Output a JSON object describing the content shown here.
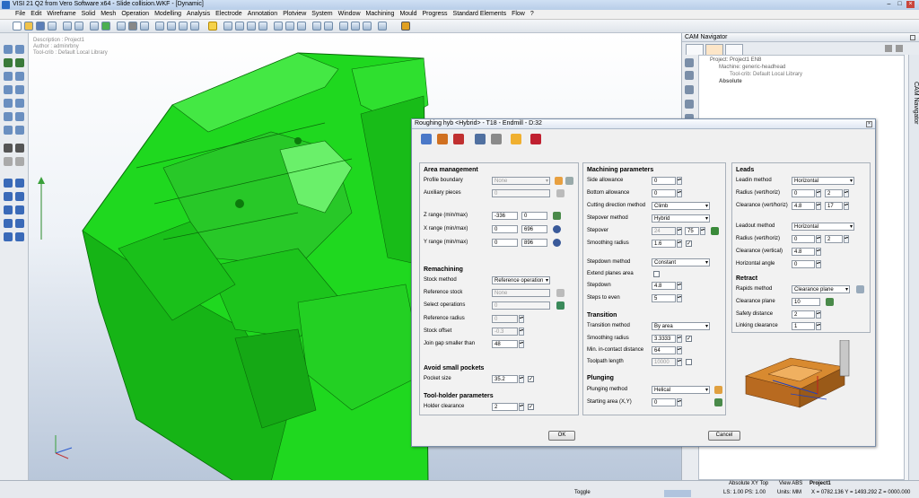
{
  "app": {
    "title": "VISI 21 Q2 from Vero Software x64 - Slide collision.WKF - [Dynamic]"
  },
  "menu": [
    "File",
    "Edit",
    "Wireframe",
    "Solid",
    "Mesh",
    "Operation",
    "Modelling",
    "Analysis",
    "Electrode",
    "Annotation",
    "Plotview",
    "System",
    "Window",
    "Machining",
    "Mould",
    "Progress",
    "Standard Elements",
    "Flow",
    "?"
  ],
  "viewport": {
    "description": "Description : Project1",
    "author": "Author : adminrbny",
    "toolcrib": "Tool-crib : Default Local Library"
  },
  "cam": {
    "title": "CAM Navigator",
    "tree": [
      "Project: Project1 EN8",
      "Machine: generic-headhead",
      "Tool-crib: Default Local Library",
      "Absolute"
    ],
    "vtab": "CAM Navigator"
  },
  "dialog": {
    "title": "Roughing hyb <Hybrid> - T18 - Endmill - D:32",
    "area": {
      "header": "Area management",
      "profile_boundary": "Profile boundary",
      "profile_boundary_val": "None",
      "aux_pieces": "Auxiliary pieces",
      "aux_pieces_val": "0",
      "z_range": "Z range (min/max)",
      "z_min": "-336",
      "z_max": "0",
      "x_range": "X range (min/max)",
      "x_min": "0",
      "x_max": "696",
      "y_range": "Y range (min/max)",
      "y_min": "0",
      "y_max": "896"
    },
    "remach": {
      "header": "Remachining",
      "stock_method": "Stock method",
      "stock_method_val": "Reference operation",
      "ref_stock": "Reference stock",
      "ref_stock_val": "None",
      "select_ops": "Select operations",
      "select_ops_val": "0",
      "ref_radius": "Reference radius",
      "ref_radius_val": "0",
      "stock_offset": "Stock offset",
      "stock_offset_val": "-0.3",
      "join_gap": "Join gap smaller than",
      "join_gap_val": "48"
    },
    "avoid": {
      "header": "Avoid small pockets",
      "pocket_size": "Pocket size",
      "pocket_size_val": "35.2"
    },
    "holder": {
      "header": "Tool-holder parameters",
      "clearance": "Holder clearance",
      "clearance_val": "2"
    },
    "mach": {
      "header": "Machining parameters",
      "side_allow": "Side allowance",
      "side_allow_val": "0",
      "bottom_allow": "Bottom allowance",
      "bottom_allow_val": "0",
      "cut_dir": "Cutting direction method",
      "cut_dir_val": "Climb",
      "stepover_method": "Stepover method",
      "stepover_method_val": "Hybrid",
      "stepover": "Stepover",
      "stepover_a": "24",
      "stepover_b": "75",
      "smooth_radius": "Smoothing radius",
      "smooth_radius_val": "1.6",
      "stepdown_method": "Stepdown method",
      "stepdown_method_val": "Constant",
      "extend_planes": "Extend planes area",
      "stepdown": "Stepdown",
      "stepdown_val": "4.8",
      "steps_even": "Steps to even",
      "steps_even_val": "5"
    },
    "transition": {
      "header": "Transition",
      "method": "Transition method",
      "method_val": "By area",
      "smooth": "Smoothing radius",
      "smooth_val": "3.3333",
      "min_contact": "Min. in-contact distance",
      "min_contact_val": "64",
      "toolpath_len": "Toolpath length",
      "toolpath_len_val": "10000"
    },
    "plunging": {
      "header": "Plunging",
      "method": "Plunging method",
      "method_val": "Helical",
      "start_area": "Starting area (X,Y)",
      "start_area_val": "0"
    },
    "leads": {
      "header": "Leads",
      "leadin": "Leadin method",
      "leadin_val": "Horizontal",
      "radius_in": "Radius (vert/horiz)",
      "radius_in_a": "0",
      "radius_in_b": "2",
      "clear_in": "Clearance (vert/horiz)",
      "clear_in_a": "4.8",
      "clear_in_b": "17",
      "leadout": "Leadout method",
      "leadout_val": "Horizontal",
      "radius_out": "Radius (vert/horiz)",
      "radius_out_a": "0",
      "radius_out_b": "2",
      "clear_out": "Clearance (vertical)",
      "clear_out_val": "4.8",
      "horiz_angle": "Horizontal angle",
      "horiz_angle_val": "0"
    },
    "retract": {
      "header": "Retract",
      "rapids": "Rapids method",
      "rapids_val": "Clearance plane",
      "clear_plane": "Clearance plane",
      "clear_plane_val": "10",
      "safety": "Safety distance",
      "safety_val": "2",
      "linking": "Linking clearance",
      "linking_val": "1"
    },
    "ok": "OK",
    "cancel": "Cancel"
  },
  "status": {
    "view": "Absolute XY Top",
    "view_abs": "View ABS",
    "project": "Project1",
    "toggle": "Toggle",
    "ls": "LS: 1.00 PS: 1.00",
    "units": "Units: MM",
    "coords": "X = 0782.136 Y = 1493.292 Z = 0000.000"
  },
  "colors": {
    "model": "#1fd81f",
    "model_dark": "#12a812",
    "accent": "#d06010"
  }
}
